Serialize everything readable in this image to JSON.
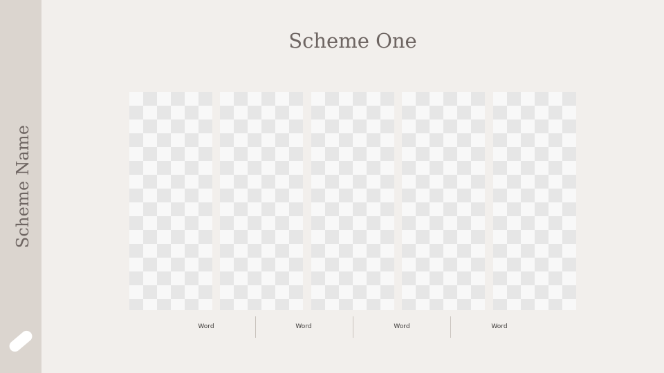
{
  "sidebar": {
    "title": "Scheme Name"
  },
  "page": {
    "title": "Scheme One"
  },
  "labels": [
    "Word",
    "Word",
    "Word",
    "Word"
  ],
  "colors": {
    "background": "#f2efec",
    "sidebar": "#dbd5cf",
    "text": "#6e6562"
  },
  "icons": {
    "sidebar_icon": "pill-icon"
  }
}
